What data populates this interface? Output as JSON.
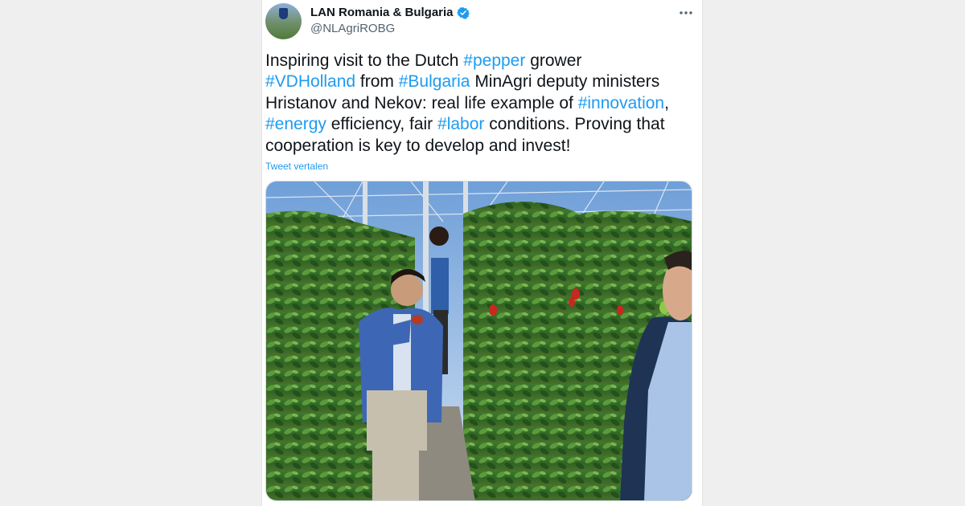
{
  "tweet": {
    "author_name": "LAN Romania & Bulgaria",
    "author_handle": "@NLAgriROBG",
    "text_segments": [
      {
        "text": "Inspiring visit to the Dutch ",
        "type": "text"
      },
      {
        "text": "#pepper",
        "type": "hashtag"
      },
      {
        "text": " grower ",
        "type": "text"
      },
      {
        "text": "#VDHolland",
        "type": "hashtag"
      },
      {
        "text": " from ",
        "type": "text"
      },
      {
        "text": "#Bulgaria",
        "type": "hashtag"
      },
      {
        "text": " MinAgri deputy ministers Hristanov and Nekov: real life example of ",
        "type": "text"
      },
      {
        "text": "#innovation",
        "type": "hashtag"
      },
      {
        "text": ", ",
        "type": "text"
      },
      {
        "text": "#energy",
        "type": "hashtag"
      },
      {
        "text": " efficiency, fair ",
        "type": "text"
      },
      {
        "text": "#labor",
        "type": "hashtag"
      },
      {
        "text": " conditions. Proving that cooperation is key to develop and invest!",
        "type": "text"
      }
    ],
    "translate_label": "Tweet vertalen",
    "verified": true
  },
  "colors": {
    "hashtag": "#1d9bf0",
    "text": "#0f1419",
    "secondary": "#536471",
    "verified_badge": "#1d9bf0"
  },
  "icons": {
    "more": "more-horizontal-icon",
    "verified": "verified-badge-icon"
  }
}
